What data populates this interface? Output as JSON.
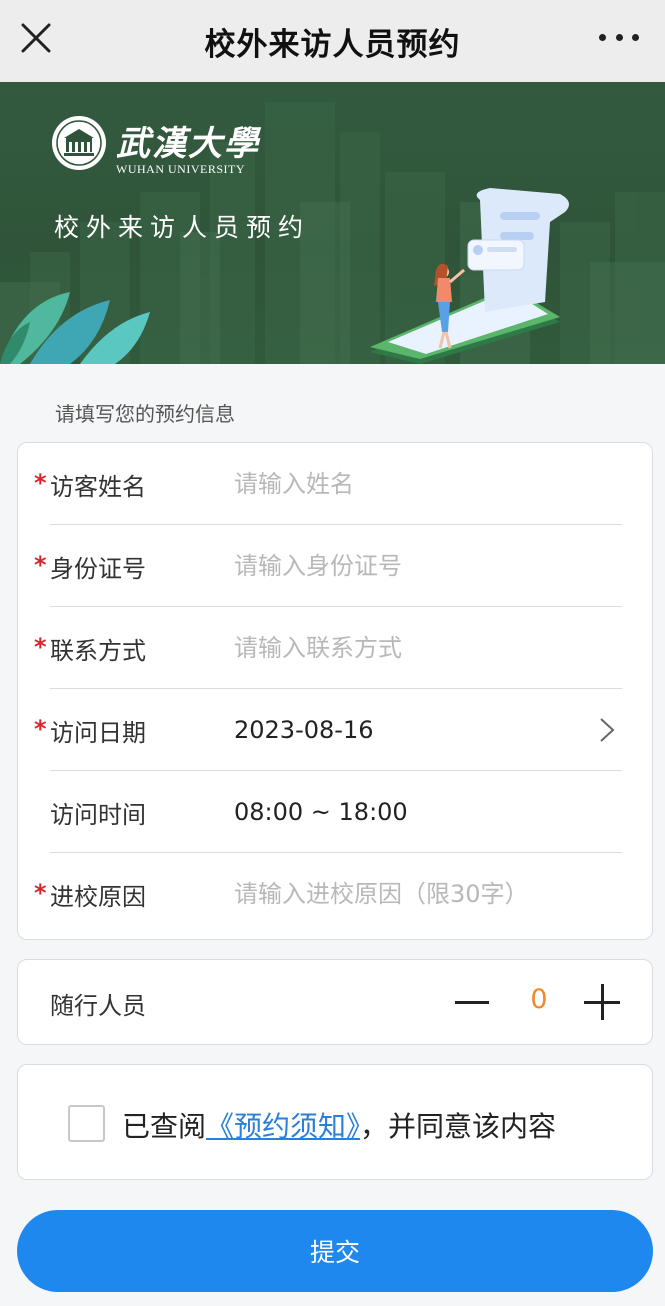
{
  "navbar": {
    "title": "校外来访人员预约",
    "close_icon": "close-icon",
    "more_icon": "more-icon"
  },
  "banner": {
    "logo_cn": "武漢大學",
    "logo_en": "WUHAN UNIVERSITY",
    "title": "校外来访人员预约",
    "background_color": "#2f5439"
  },
  "form": {
    "section_hint": "请填写您的预约信息",
    "rows": [
      {
        "label": "访客姓名",
        "required": true,
        "placeholder": "请输入姓名",
        "value": ""
      },
      {
        "label": "身份证号",
        "required": true,
        "placeholder": "请输入身份证号",
        "value": ""
      },
      {
        "label": "联系方式",
        "required": true,
        "placeholder": "请输入联系方式",
        "value": ""
      },
      {
        "label": "访问日期",
        "required": true,
        "value": "2023-08-16",
        "icon": "chevron-right-icon"
      },
      {
        "label": "访问时间",
        "required": false,
        "value": "08:00 ~ 18:00"
      },
      {
        "label": "进校原因",
        "required": true,
        "placeholder": "请输入进校原因（限30字）",
        "value": ""
      }
    ],
    "required_mark": "*",
    "required_color": "#d8262f"
  },
  "companions": {
    "label": "随行人员",
    "count": "0",
    "count_color": "#f0892c"
  },
  "agreement": {
    "prefix": "已查阅",
    "link": "《预约须知》",
    "suffix": "，并同意该内容",
    "link_color": "#2a7fd8",
    "checked": false
  },
  "submit": {
    "label": "提交",
    "color": "#1f88ee"
  }
}
